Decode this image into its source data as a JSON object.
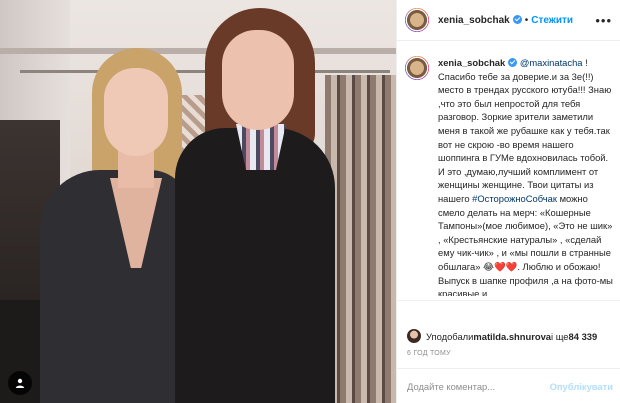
{
  "header": {
    "username": "xenia_sobchak",
    "dot": "•",
    "follow_label": "Стежити",
    "more_label": "•••"
  },
  "caption": {
    "username": "xenia_sobchak",
    "mention": "@maxinatacha",
    "text_1": " ! Спасибо тебе за доверие.и за 3е(!!) место в трендах русского ютуба!!! Знаю ,что это был непростой для тебя разговор. Зоркие зрители заметили меня в такой же рубашке как у тебя.так вот не скрою -во время нашего шоппинга в ГУМе вдохновилась тобой. И это ,думаю,лучший комплимент от женщины женщине. Твои цитаты из нашего ",
    "hashtag": "#ОсторожноСобчак",
    "text_2": " можно смело делать на мерч: «Кошерные Тампоны»(мое любимое), «Это не шик» , «Крестьянские натуралы» , «сделай ему чик-чик» , и «мы пошли в странные обшлага» 😂❤️❤️. Люблю и обожаю! Выпуск в шапке профиля ,а на фото-мы красивые и"
  },
  "likes": {
    "prefix": "Уподобали ",
    "user": "matilda.shnurova",
    "middle": " і ще ",
    "count": "84 339"
  },
  "timestamp": "6 ГОД ТОМУ",
  "comment": {
    "placeholder": "Додайте коментар...",
    "publish_label": "Опублікувати"
  },
  "colors": {
    "link": "#0095f6",
    "verified": "#3897f0",
    "publish_disabled": "#b2dffc",
    "muted": "#8e8e8e"
  },
  "icons": {
    "media_tag": "person-tag-icon",
    "verified": "verified-badge-icon",
    "more": "more-options-icon"
  }
}
